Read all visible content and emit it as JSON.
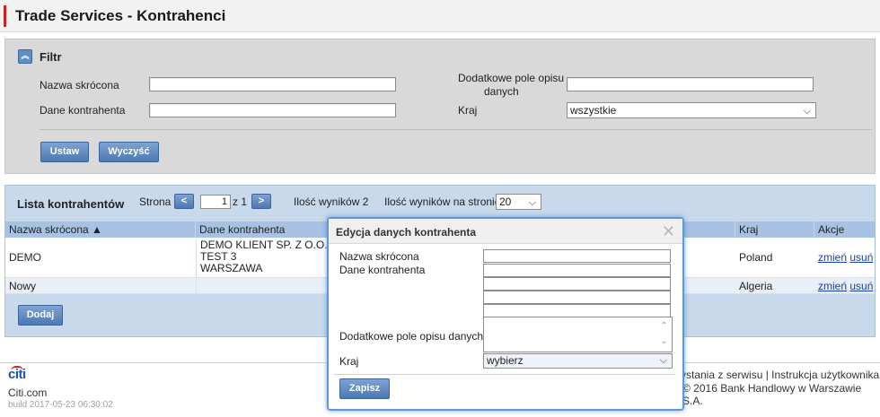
{
  "page": {
    "title": "Trade Services - Kontrahenci"
  },
  "filter": {
    "title": "Filtr",
    "labels": {
      "short_name": "Nazwa skrócona",
      "extra_field_line1": "Dodatkowe pole opisu",
      "extra_field_line2": "danych",
      "counterparty": "Dane kontrahenta",
      "country": "Kraj"
    },
    "values": {
      "short_name": "",
      "extra_field": "",
      "counterparty": "",
      "country": "wszystkie"
    },
    "buttons": {
      "set": "Ustaw",
      "clear": "Wyczyść"
    }
  },
  "list": {
    "title": "Lista kontrahentów",
    "pagination": {
      "page_label": "Strona",
      "prev": "<",
      "current": "1",
      "of_label": "z 1",
      "next": ">",
      "results": "Ilość wyników 2",
      "per_page_label": "Ilość wyników na stronie",
      "per_page": "20"
    },
    "columns": [
      "Nazwa skrócona ▲",
      "Dane kontrahenta",
      "Kraj",
      "Akcje"
    ],
    "rows": [
      {
        "short_name": "DEMO",
        "data_lines": [
          "DEMO KLIENT SP. Z O.O.",
          "TEST 3",
          "WARSZAWA"
        ],
        "country": "Poland",
        "edit": "zmień",
        "delete": "usuń"
      },
      {
        "short_name": "Nowy",
        "data_lines": [
          "",
          "",
          ""
        ],
        "country": "Algeria",
        "edit": "zmień",
        "delete": "usuń"
      }
    ],
    "add_button": "Dodaj"
  },
  "footer": {
    "logo": "citi",
    "site": "Citi.com",
    "build": "build 2017-05-23 06:30:02",
    "links": "ystania z serwisu  |  Instrukcja użytkownika",
    "copyright": "© 2016 Bank Handlowy w Warszawie S.A."
  },
  "modal": {
    "title": "Edycja danych kontrahenta",
    "close": "✕",
    "labels": {
      "short_name": "Nazwa skrócona",
      "counterparty": "Dane kontrahenta",
      "extra_field": "Dodatkowe pole opisu danych",
      "country": "Kraj"
    },
    "country_value": "wybierz",
    "save_button": "Zapisz"
  },
  "colors": {
    "accent_red": "#d02020",
    "button_blue": "#4d78b2",
    "list_bg": "#c8d9ec",
    "header_row": "#a7c2e3"
  }
}
